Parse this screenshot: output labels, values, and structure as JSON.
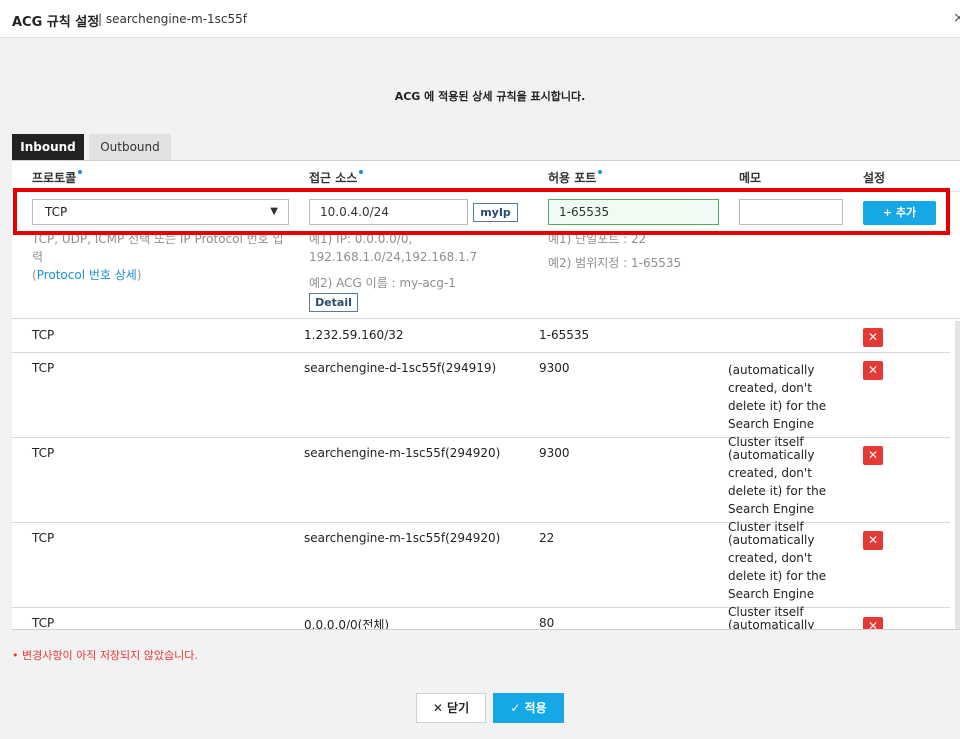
{
  "dialog": {
    "title": "ACG 규칙 설정",
    "title_rest": "| searchengine-m-1sc55f",
    "close_glyph": "×",
    "subtitle": "ACG 에 적용된 상세 규칙을 표시합니다."
  },
  "tabs": [
    {
      "label": "Inbound",
      "active": true
    },
    {
      "label": "Outbound",
      "active": false
    }
  ],
  "columns": {
    "protocol": "프로토콜",
    "source": "접근 소스",
    "port": "허용 포트",
    "memo": "메모",
    "settings": "설정"
  },
  "form": {
    "protocol_value": "TCP",
    "source_value": "10.0.4.0/24",
    "myip_label": "myIp",
    "port_value": "1-65535",
    "memo_value": "",
    "add_label": "+ 추가",
    "protocol_hint": "TCP, UDP, ICMP 선택 또는 IP Protocol 번호 입력",
    "protocol_hint_link_open": "(",
    "protocol_hint_link": "Protocol 번호 상세",
    "protocol_hint_link_close": ")",
    "source_hint_1": "예1) IP: 0.0.0.0/0,",
    "source_hint_2": "192.168.1.0/24,192.168.1.7",
    "source_hint_3": "예2) ACG 이름 : my-acg-1",
    "detail_label": "Detail",
    "port_hint_1": "예1) 단일포트 : 22",
    "port_hint_2": "예2) 범위지정 : 1-65535"
  },
  "rules": [
    {
      "protocol": "TCP",
      "source": "1.232.59.160/32",
      "port": "1-65535",
      "memo": ""
    },
    {
      "protocol": "TCP",
      "source": "searchengine-d-1sc55f(294919)",
      "port": "9300",
      "memo": "(automatically created, don't delete it) for the Search Engine Cluster itself"
    },
    {
      "protocol": "TCP",
      "source": "searchengine-m-1sc55f(294920)",
      "port": "9300",
      "memo": "(automatically created, don't delete it) for the Search Engine Cluster itself"
    },
    {
      "protocol": "TCP",
      "source": "searchengine-m-1sc55f(294920)",
      "port": "22",
      "memo": "(automatically created, don't delete it) for the Search Engine Cluster itself"
    },
    {
      "protocol": "TCP",
      "source": "0.0.0.0/0(전체)",
      "port": "80",
      "memo": "(automatically"
    }
  ],
  "delete_glyph": "✕",
  "warning": "• 변경사항이 아직 저장되지 않았습니다.",
  "buttons": {
    "close": "✕ 닫기",
    "apply": "✓ 적용"
  },
  "colors": {
    "accent": "#16a8e6",
    "danger": "#e53935",
    "highlight": "#e60000"
  }
}
